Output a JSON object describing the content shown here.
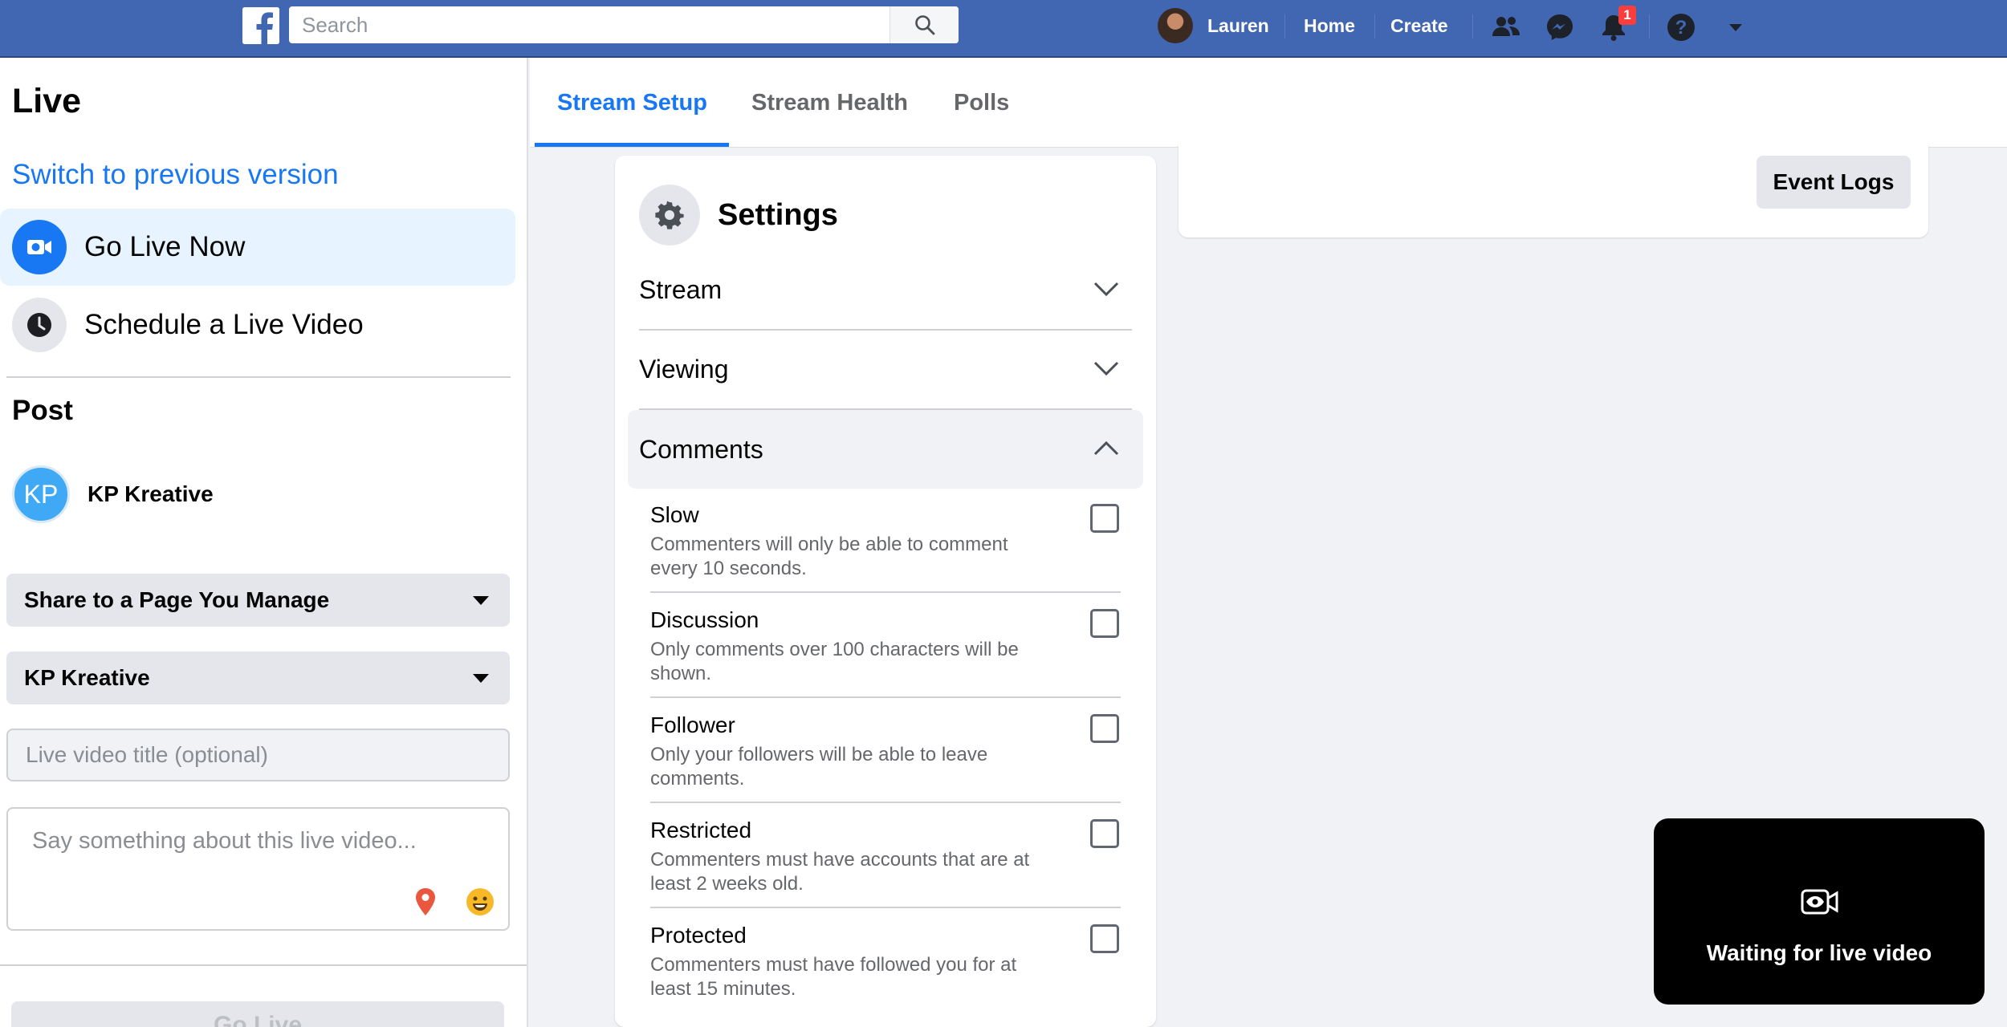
{
  "topbar": {
    "search_placeholder": "Search",
    "user_name": "Lauren",
    "home_label": "Home",
    "create_label": "Create",
    "notification_count": "1",
    "icons": [
      "facebook-logo",
      "search-icon",
      "friends-icon",
      "messenger-icon",
      "bell-icon",
      "help-icon",
      "caret-down-icon"
    ],
    "bar_color": "#4267b2"
  },
  "sidebar": {
    "title": "Live",
    "switch_link": "Switch to previous version",
    "items": [
      {
        "label": "Go Live Now",
        "icon": "video-camera-icon",
        "active": true
      },
      {
        "label": "Schedule a Live Video",
        "icon": "clock-icon",
        "active": false
      }
    ],
    "post_heading": "Post",
    "page": {
      "initials": "KP",
      "name": "KP Kreative"
    },
    "share_dropdown": "Share to a Page You Manage",
    "page_dropdown": "KP Kreative",
    "title_placeholder": "Live video title (optional)",
    "description_placeholder": "Say something about this live video...",
    "go_live_label": "Go Live"
  },
  "tabs": [
    {
      "label": "Stream Setup",
      "active": true
    },
    {
      "label": "Stream Health",
      "active": false
    },
    {
      "label": "Polls",
      "active": false
    }
  ],
  "settings": {
    "title": "Settings",
    "sections": [
      {
        "label": "Stream",
        "expanded": false
      },
      {
        "label": "Viewing",
        "expanded": false
      },
      {
        "label": "Comments",
        "expanded": true
      }
    ],
    "comment_options": [
      {
        "title": "Slow",
        "description": "Commenters will only be able to comment every 10 seconds.",
        "checked": false
      },
      {
        "title": "Discussion",
        "description": "Only comments over 100 characters will be shown.",
        "checked": false
      },
      {
        "title": "Follower",
        "description": "Only your followers will be able to leave comments.",
        "checked": false
      },
      {
        "title": "Restricted",
        "description": "Commenters must have accounts that are at least 2 weeks old.",
        "checked": false
      },
      {
        "title": "Protected",
        "description": "Commenters must have followed you for at least 15 minutes.",
        "checked": false
      }
    ]
  },
  "event_logs_label": "Event Logs",
  "preview": {
    "status": "Waiting for live video",
    "icon": "eye-camera-icon"
  },
  "colors": {
    "accent": "#1877f2",
    "active_bg": "#e7f3ff",
    "page_avatar": "#3fa9f5"
  }
}
